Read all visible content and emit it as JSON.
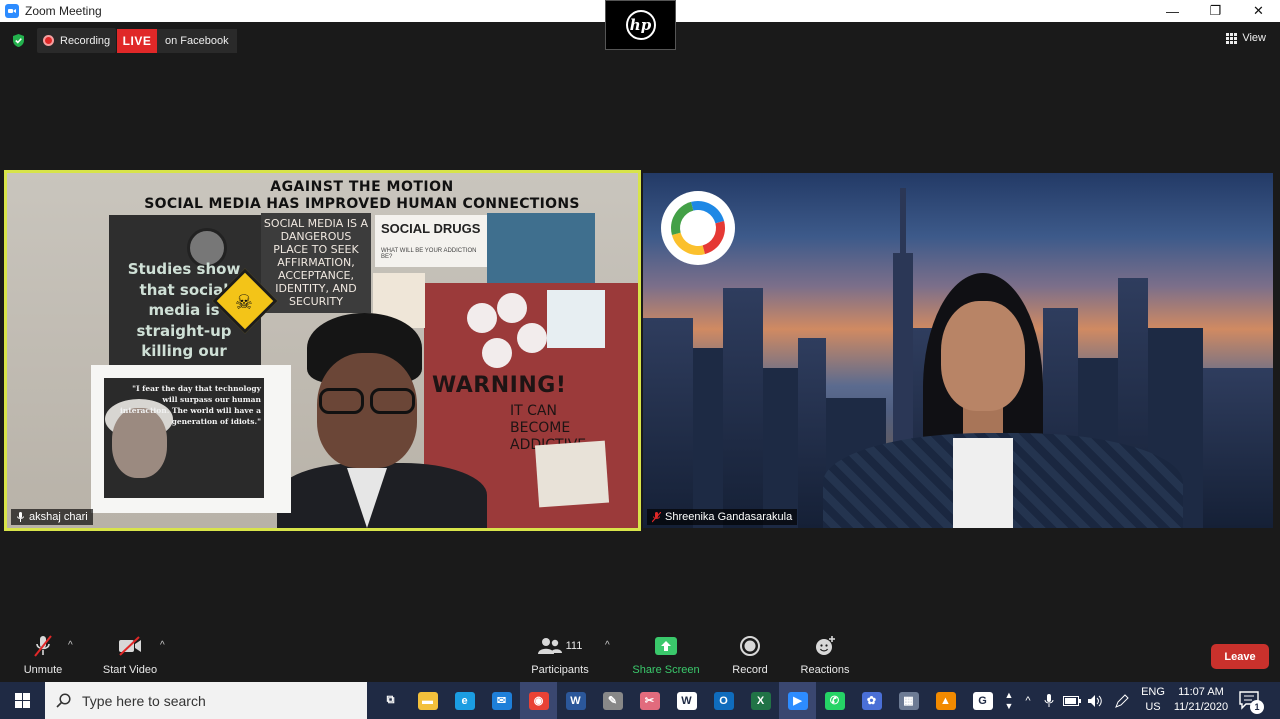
{
  "window": {
    "title": "Zoom Meeting",
    "minimize": "—",
    "restore": "❐",
    "close": "✕"
  },
  "overlay_logo": "hp",
  "status": {
    "recording_label": "Recording",
    "live_label": "LIVE",
    "live_target": "on Facebook",
    "view_label": "View"
  },
  "participants": [
    {
      "name": "akshaj chari",
      "active_speaker": true,
      "poster": {
        "title_line1": "AGAINST THE  MOTION",
        "title_line2": "SOCIAL MEDIA  HAS IMPROVED HUMAN  CONNECTIONS",
        "dark_panel_text": "Studies show that social media is straight-up killing our",
        "center_panel_text": "SOCIAL MEDIA IS A DANGEROUS PLACE TO SEEK AFFIRMATION, ACCEPTANCE, IDENTITY, AND SECURITY",
        "drugs_panel_title": "SOCIAL  DRUGS",
        "drugs_panel_sub": "WHAT WILL BE YOUR ADDICTION BE?",
        "warning_text": "WARNING!",
        "warning_sub": "IT CAN BECOME ADDICTIVE",
        "quote": "\"I fear the day that technology will surpass our human interaction. The world will have a generation of idiots.\""
      }
    },
    {
      "name": "Shreenika Gandasarakula",
      "active_speaker": false
    }
  ],
  "toolbar": {
    "unmute_label": "Unmute",
    "start_video_label": "Start Video",
    "participants_label": "Participants",
    "participants_count": "111",
    "share_screen_label": "Share Screen",
    "record_label": "Record",
    "reactions_label": "Reactions",
    "leave_label": "Leave",
    "caret": "^"
  },
  "taskbar": {
    "search_placeholder": "Type here to search",
    "language_line1": "ENG",
    "language_line2": "US",
    "time": "11:07 AM",
    "date": "11/21/2020",
    "notification_count": "1",
    "apps": [
      {
        "name": "task-view",
        "glyph": "⧉"
      },
      {
        "name": "file-explorer",
        "glyph": "▬",
        "color": "#f3c03b"
      },
      {
        "name": "edge",
        "glyph": "e",
        "color": "#1b9de2"
      },
      {
        "name": "mail",
        "glyph": "✉",
        "color": "#1e7fd9"
      },
      {
        "name": "chrome",
        "glyph": "◉",
        "color": "#e94235"
      },
      {
        "name": "word",
        "glyph": "W",
        "color": "#2b579a"
      },
      {
        "name": "pen-app",
        "glyph": "✎",
        "color": "#888888"
      },
      {
        "name": "snip-app",
        "glyph": "✂",
        "color": "#e26b7d"
      },
      {
        "name": "w-app",
        "glyph": "W",
        "color": "#ffffff"
      },
      {
        "name": "outlook",
        "glyph": "O",
        "color": "#0f6cbd"
      },
      {
        "name": "excel",
        "glyph": "X",
        "color": "#217346"
      },
      {
        "name": "zoom",
        "glyph": "▶",
        "color": "#2d8cff"
      },
      {
        "name": "whatsapp",
        "glyph": "✆",
        "color": "#25d366"
      },
      {
        "name": "settings-app",
        "glyph": "✿",
        "color": "#4a6fd6"
      },
      {
        "name": "calculator",
        "glyph": "▦",
        "color": "#6d7b94"
      },
      {
        "name": "vlc",
        "glyph": "▲",
        "color": "#f28a00"
      },
      {
        "name": "g-app",
        "glyph": "G",
        "color": "#ffffff"
      }
    ]
  },
  "colors": {
    "live_red": "#e02828",
    "active_speaker_border": "#d8e44a",
    "share_green": "#3ac86b",
    "leave_red": "#c9312c",
    "taskbar": "#1f2a44"
  }
}
